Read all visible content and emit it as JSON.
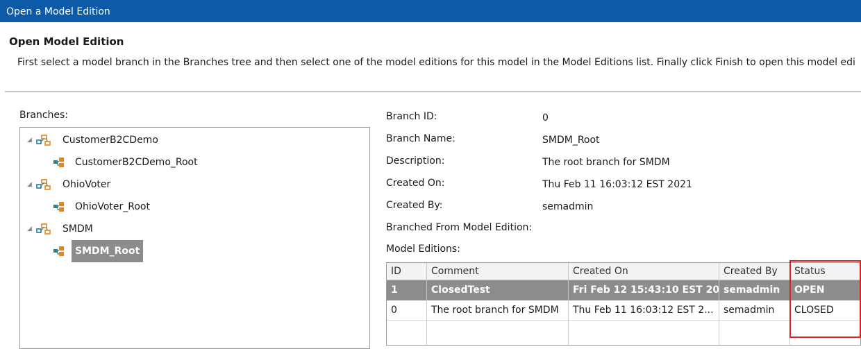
{
  "window": {
    "title": "Open a Model Edition"
  },
  "header": {
    "title": "Open Model Edition",
    "description": "First select a model branch in the Branches tree and then select one of the model editions for this model in the Model Editions list. Finally click Finish to open this model edi"
  },
  "branches": {
    "label": "Branches:",
    "items": [
      {
        "label": "CustomerB2CDemo",
        "child": "CustomerB2CDemo_Root"
      },
      {
        "label": "OhioVoter",
        "child": "OhioVoter_Root"
      },
      {
        "label": "SMDM",
        "child": "SMDM_Root"
      }
    ]
  },
  "details": {
    "branch_id_label": "Branch ID:",
    "branch_id": "0",
    "branch_name_label": "Branch Name:",
    "branch_name": "SMDM_Root",
    "description_label": "Description:",
    "description": "The root branch for SMDM",
    "created_on_label": "Created On:",
    "created_on": "Thu Feb 11 16:03:12 EST 2021",
    "created_by_label": "Created By:",
    "created_by": "semadmin",
    "branched_from_label": "Branched From Model Edition:",
    "model_editions_label": "Model Editions:"
  },
  "editions": {
    "columns": [
      "ID",
      "Comment",
      "Created On",
      "Created By",
      "Status"
    ],
    "rows": [
      {
        "id": "1",
        "comment": "ClosedTest",
        "created_on": "Fri Feb 12 15:43:10 EST 20...",
        "created_by": "semadmin",
        "status": "OPEN"
      },
      {
        "id": "0",
        "comment": "The root branch for SMDM",
        "created_on": "Thu Feb 11 16:03:12 EST 2...",
        "created_by": "semadmin",
        "status": "CLOSED"
      }
    ]
  },
  "colors": {
    "titlebar": "#0c5aa8",
    "selection": "#8c8c8c",
    "highlight": "#e02020",
    "icon_orange": "#e8841c",
    "icon_teal": "#2a7f8f"
  }
}
